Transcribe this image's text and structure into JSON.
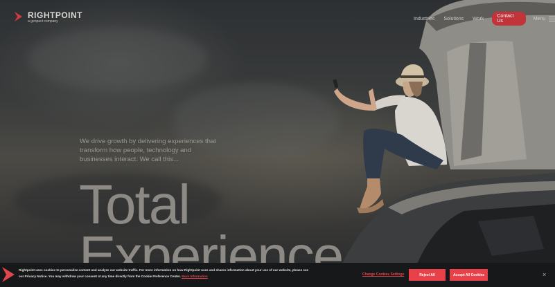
{
  "header": {
    "logo_word": "RIGHTPOINT",
    "logo_sub": "a genpact company",
    "nav": [
      "Industries",
      "Solutions",
      "Work"
    ],
    "contact_label": "Contact Us",
    "menu_label": "Menu"
  },
  "hero": {
    "intro": "We drive growth by delivering experiences that transform how people, technology and businesses interact. We call this...",
    "headline_1": "Total",
    "headline_2": "Experience"
  },
  "cookie": {
    "text_main": "Rightpoint uses cookies to personalize content and analyze our website traffic. For more information on how Rightpoint uses and shares information about your use of our website, please see our Privacy Notice. You may withdraw your consent at any time directly from the Cookie Preference Center.",
    "more_info": "More Information",
    "change_settings": "Change Cookies Settings",
    "reject": "Reject All",
    "accept": "Accept All Cookies",
    "close": "×"
  },
  "colors": {
    "brand_red": "#c2343a",
    "cookie_button": "#e8414a"
  }
}
